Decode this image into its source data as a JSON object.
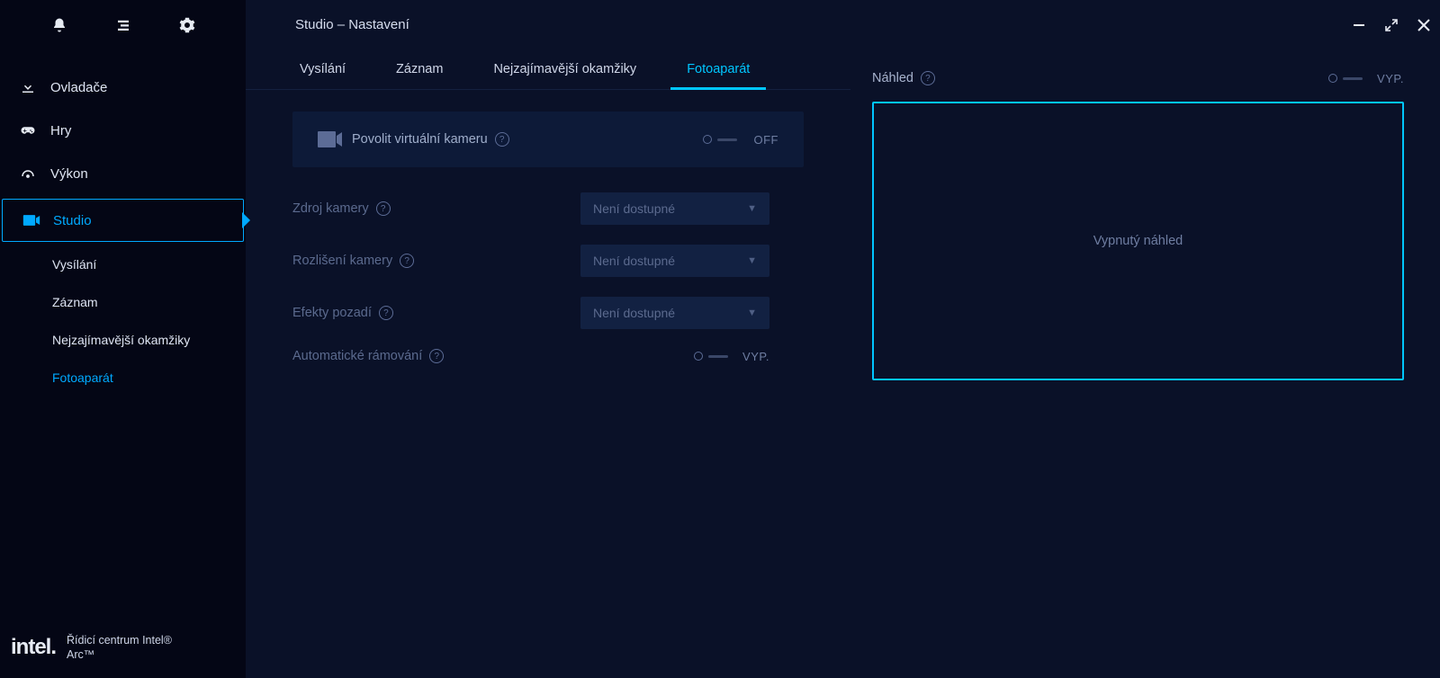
{
  "titlebar": {
    "title": "Studio – Nastavení"
  },
  "sidebar": {
    "items": [
      {
        "label": "Ovladače"
      },
      {
        "label": "Hry"
      },
      {
        "label": "Výkon"
      },
      {
        "label": "Studio"
      }
    ],
    "sub_items": [
      {
        "label": "Vysílání"
      },
      {
        "label": "Záznam"
      },
      {
        "label": "Nejzajímavější okamžiky"
      },
      {
        "label": "Fotoaparát"
      }
    ],
    "brand": {
      "logo": "intel.",
      "line1": "Řídicí centrum Intel®",
      "line2": "Arc™"
    }
  },
  "tabs": [
    {
      "label": "Vysílání"
    },
    {
      "label": "Záznam"
    },
    {
      "label": "Nejzajímavější okamžiky"
    },
    {
      "label": "Fotoaparát"
    }
  ],
  "panel": {
    "label": "Povolit virtuální kameru",
    "state": "OFF"
  },
  "rows": {
    "camera_source": {
      "label": "Zdroj kamery",
      "value": "Není dostupné"
    },
    "camera_res": {
      "label": "Rozlišení kamery",
      "value": "Není dostupné"
    },
    "bg_effects": {
      "label": "Efekty pozadí",
      "value": "Není dostupné"
    },
    "auto_frame": {
      "label": "Automatické rámování",
      "state": "VYP."
    }
  },
  "preview": {
    "title": "Náhled",
    "state": "VYP.",
    "message": "Vypnutý náhled"
  }
}
